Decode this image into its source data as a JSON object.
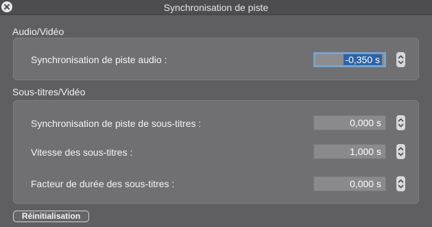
{
  "window": {
    "title": "Synchronisation de piste"
  },
  "audio_video": {
    "title": "Audio/Vidéo",
    "audio_sync": {
      "label": "Synchronisation de piste audio :",
      "value": "-0,350",
      "unit": "s"
    }
  },
  "subtitles_video": {
    "title": "Sous-titres/Vidéo",
    "subtitle_sync": {
      "label": "Synchronisation de piste de sous-titres :",
      "value": "0,000 s"
    },
    "subtitle_speed": {
      "label": "Vitesse des sous-titres :",
      "value": "1,000 s"
    },
    "subtitle_duration": {
      "label": "Facteur de durée des sous-titres :",
      "value": "0,000 s"
    }
  },
  "reset_button": {
    "label": "Réinitialisation"
  },
  "icons": {
    "close": "close-icon",
    "stepper": "stepper-arrows-icon"
  },
  "colors": {
    "selection": "#2d64a4",
    "focus_ring": "#7aa3c9"
  }
}
